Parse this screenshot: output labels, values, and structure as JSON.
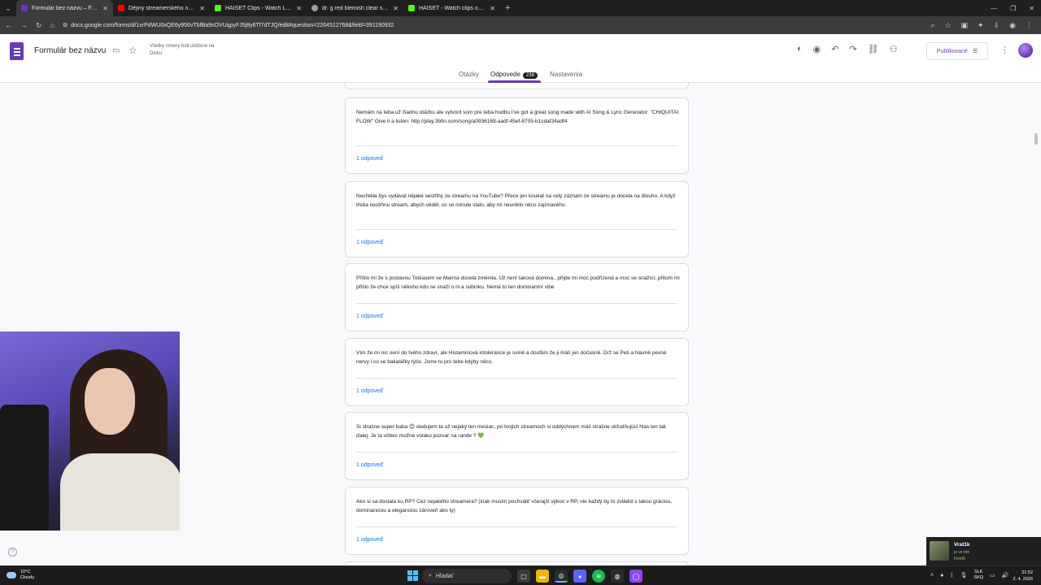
{
  "browser": {
    "tabs": [
      {
        "title": "Formulár bez názvu – Formulár",
        "favicon_color": "#673ab7",
        "active": true
      },
      {
        "title": "Dějiny streamerského národa",
        "favicon_color": "#ff0000",
        "active": false
      },
      {
        "title": "HAISET Clips - Watch Live on K",
        "favicon_color": "#53fc18",
        "active": false
      },
      {
        "title": "dr. g red blemish clear soothin",
        "favicon_color": "#9e9e9e",
        "active": false
      },
      {
        "title": "HAISET - Watch clips on Kick",
        "favicon_color": "#53fc18",
        "active": false
      }
    ],
    "url": "docs.google.com/forms/d/1xrPdWU0xQE6y956vTbfBa9sOVUqpyFJ5j8y6Tf7dTJQ/edit#question=2264512768&field=391190932"
  },
  "header": {
    "doc_title": "Formulár bez názvu",
    "saved_status": "Všetky zmeny boli uložené na Disku",
    "publish_label": "Publikované",
    "accent_color": "#673ab7"
  },
  "form_tabs": [
    {
      "label": "Otázky"
    },
    {
      "label": "Odpovede",
      "count": "238"
    },
    {
      "label": "Nastavenia"
    }
  ],
  "cards": [
    {
      "text": "Nemám na teba už žiadnu otázku ale vytvoril som pre teba hudbu I've got a great song made with AI Song & Lyric Generator: \"CHIQUITAI FLOW\" Give it a listen: http://play.3bfin.com/song/a0936169-aadf-45ef-8705-b1cdaf34adf4",
      "responses": "1 odpoveď"
    },
    {
      "text": "Nechtěla bys vydávat nějaké sestřihy ze streamu na YouTube? Přece jen koukat na celý záznam ze streamu je docela na dlouho. A když třeba nestihnu stream, abych věděl, co se minule stalo, aby mi neuniklo něco zajímavého.",
      "responses": "1 odpoveď"
    },
    {
      "text": "Přišlo mi že s postavou Tobiasem se Marina docela změnila. Už není taková domina.. přijde mi moc podřízená a moc se snažící, přitom mi přišlo že chce spíš někoho kdo se snaží o ni a subinku. Nemá to ten dominantní vibe",
      "responses": "1 odpoveď"
    },
    {
      "text": "Vím že mi nic není do tvého zdraví, ale Histaminová intolerance je svině a doufám že ji máš jen dočasně. Drž se Peti a hlavně pevné nervy i co se bakalářky týče. Jsme tu pro tebe kdyby něco.",
      "responses": "1 odpoveď"
    },
    {
      "text": "Si strašne super baba 😊 sledujem ta už nejaký ten mesiac, pri tvojich streamoch si oddýchnem máš strašne ukľudňujúci hlas len tak ďalej. Je ta vôbec možné volako pozvať na rande ? 💚",
      "responses": "1 odpoveď"
    },
    {
      "text": "Ako si sa dostala ku RP? Cez nejakého streamera? (inak musim pochváliť včerajší výkon v RP, nie každý by to zvládol s takou gráciou, dominanciou a eleganciou zároveň ako ty)",
      "responses": "1 odpoveď"
    }
  ],
  "notification": {
    "name": "Vrat1k",
    "line2": "je ve hře",
    "line3": "FiveM"
  },
  "taskbar": {
    "weather_temp": "10°C",
    "weather_desc": "Cloudy",
    "search_placeholder": "Hľadať",
    "lang_top": "SLK",
    "lang_bottom": "SKQ",
    "time": "21:52",
    "date": "2. 4. 2026"
  }
}
